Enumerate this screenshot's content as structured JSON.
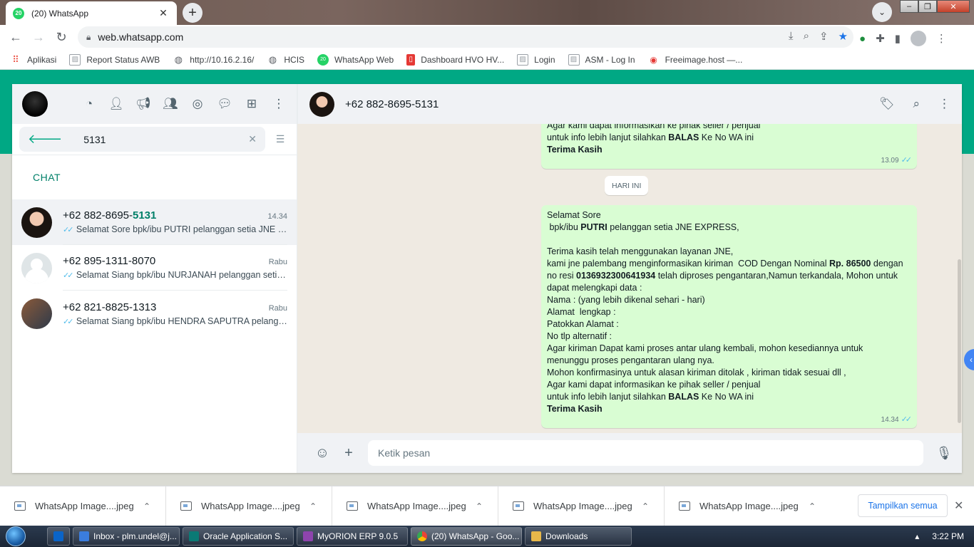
{
  "browser": {
    "tab_title": "(20) WhatsApp",
    "tab_favicon_text": "20",
    "url": "web.whatsapp.com",
    "bookmarks": [
      {
        "label": "Aplikasi",
        "icon": "apps-grid-icon"
      },
      {
        "label": "Report Status AWB",
        "icon": "broken-image-icon"
      },
      {
        "label": "http://10.16.2.16/",
        "icon": "globe-icon"
      },
      {
        "label": "HCIS",
        "icon": "globe-icon"
      },
      {
        "label": "WhatsApp Web",
        "icon": "whatsapp-icon"
      },
      {
        "label": "Dashboard HVO HV...",
        "icon": "document-icon"
      },
      {
        "label": "Login",
        "icon": "broken-image-icon"
      },
      {
        "label": "ASM - Log In",
        "icon": "broken-image-icon"
      },
      {
        "label": "Freeimage.host —...",
        "icon": "freeimage-icon"
      }
    ]
  },
  "sidebar": {
    "search_value": "5131",
    "section_label": "CHAT",
    "chats": [
      {
        "name_prefix": "+62 882-8695-",
        "name_match": "5131",
        "time": "14.34",
        "preview": "Selamat Sore  bpk/ibu PUTRI pelanggan setia JNE EXPRESS,"
      },
      {
        "name_prefix": "+62 895-1311-8070",
        "name_match": "",
        "time": "Rabu",
        "preview": "Selamat Siang   bpk/ibu NURJANAH pelanggan setia JNE EXPRESS,"
      },
      {
        "name_prefix": "+62 821-8825-1313",
        "name_match": "",
        "time": "Rabu",
        "preview": "Selamat Siang   bpk/ibu HENDRA SAPUTRA pelanggan setia JNE EXPRESS,"
      }
    ]
  },
  "conversation": {
    "contact": "+62 882-8695-5131",
    "date_separator": "HARI INI",
    "composer_placeholder": "Ketik pesan",
    "messages": [
      {
        "time": "13.09",
        "lines": [
          [
            {
              "t": "Agar kami dapat informasikan ke pihak seller / penjual"
            }
          ],
          [
            {
              "t": "untuk info lebih lanjut silahkan "
            },
            {
              "t": "BALAS",
              "b": true
            },
            {
              "t": " Ke No WA ini"
            }
          ],
          [
            {
              "t": "Terima Kasih",
              "b": true
            }
          ]
        ]
      },
      {
        "time": "14.34",
        "lines": [
          [
            {
              "t": "Selamat Sore"
            }
          ],
          [
            {
              "t": " bpk/ibu "
            },
            {
              "t": "PUTRI",
              "b": true
            },
            {
              "t": " pelanggan setia JNE EXPRESS,"
            }
          ],
          [
            {
              "t": ""
            }
          ],
          [
            {
              "t": "Terima kasih telah menggunakan layanan JNE,"
            }
          ],
          [
            {
              "t": "kami jne palembang menginformasikan kiriman  COD Dengan Nominal "
            },
            {
              "t": "Rp. 86500",
              "b": true
            },
            {
              "t": " dengan"
            }
          ],
          [
            {
              "t": "no resi "
            },
            {
              "t": "0136932300641934",
              "b": true
            },
            {
              "t": " telah diproses pengantaran,Namun terkandala, Mohon untuk"
            }
          ],
          [
            {
              "t": "dapat melengkapi data :"
            }
          ],
          [
            {
              "t": "Nama : (yang lebih dikenal sehari - hari)"
            }
          ],
          [
            {
              "t": "Alamat  lengkap :"
            }
          ],
          [
            {
              "t": "Patokkan Alamat :"
            }
          ],
          [
            {
              "t": "No tlp alternatif :"
            }
          ],
          [
            {
              "t": "Agar kiriman Dapat kami proses antar ulang kembali, mohon kesediannya untuk"
            }
          ],
          [
            {
              "t": "menunggu proses pengantaran ulang nya."
            }
          ],
          [
            {
              "t": "Mohon konfirmasinya untuk alasan kiriman ditolak , kiriman tidak sesuai dll ,"
            }
          ],
          [
            {
              "t": "Agar kami dapat informasikan ke pihak seller / penjual"
            }
          ],
          [
            {
              "t": "untuk info lebih lanjut silahkan "
            },
            {
              "t": "BALAS",
              "b": true
            },
            {
              "t": " Ke No WA ini"
            }
          ],
          [
            {
              "t": "Terima Kasih",
              "b": true
            }
          ]
        ]
      }
    ]
  },
  "downloads": {
    "items": [
      "WhatsApp Image....jpeg",
      "WhatsApp Image....jpeg",
      "WhatsApp Image....jpeg",
      "WhatsApp Image....jpeg",
      "WhatsApp Image....jpeg"
    ],
    "show_all": "Tampilkan semua"
  },
  "taskbar": {
    "items": [
      {
        "label": "Inbox - plm.undel@j...",
        "color": "#3b7ddd"
      },
      {
        "label": "Oracle Application S...",
        "color": "#0b7a75"
      },
      {
        "label": "MyORION ERP 9.0.5",
        "color": "#8e44ad"
      },
      {
        "label": "(20) WhatsApp - Goo...",
        "color": "#f4b400"
      },
      {
        "label": "Downloads",
        "color": "#e8b84a"
      }
    ],
    "clock": "3:22 PM"
  },
  "colors": {
    "accent": "#00a884",
    "bubble_out": "#d9fdd3",
    "tick_read": "#53bdeb"
  }
}
